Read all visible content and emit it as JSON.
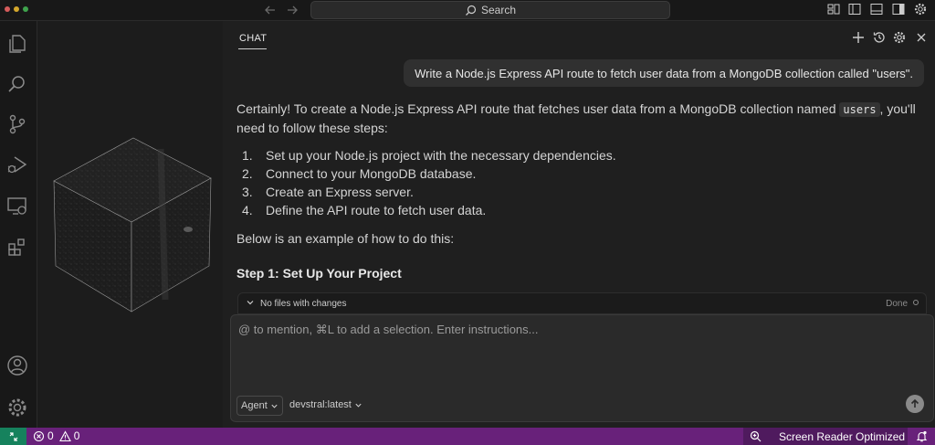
{
  "window": {
    "search_label": "Search"
  },
  "activity_bar": {
    "items": [
      "explorer-icon",
      "search-icon",
      "source-control-icon",
      "run-debug-icon",
      "remote-explorer-icon",
      "extensions-icon"
    ],
    "bottom": [
      "accounts-icon",
      "manage-gear-icon"
    ]
  },
  "chat": {
    "tab_label": "CHAT",
    "header_icons": [
      "new-chat-icon",
      "history-icon",
      "settings-icon",
      "close-icon"
    ],
    "user_message": "Write a Node.js Express API route to fetch user data from a MongoDB collection called \"users\".",
    "answer": {
      "intro_before_code": "Certainly! To create a Node.js Express API route that fetches user data from a MongoDB collection named ",
      "intro_code": "users",
      "intro_after_code": ", you'll need to follow these steps:",
      "steps": [
        {
          "num": "1.",
          "text": "Set up your Node.js project with the necessary dependencies."
        },
        {
          "num": "2.",
          "text": "Connect to your MongoDB database."
        },
        {
          "num": "3.",
          "text": "Create an Express server."
        },
        {
          "num": "4.",
          "text": "Define the API route to fetch user data."
        }
      ],
      "below_text": "Below is an example of how to do this:",
      "step1_heading": "Step 1: Set Up Your Project"
    },
    "changes_bar": {
      "label": "No files with changes",
      "done_label": "Done"
    },
    "input": {
      "placeholder": "@ to mention, ⌘L to add a selection. Enter instructions...",
      "value": "",
      "mode": "Agent",
      "model": "devstral:latest"
    }
  },
  "status_bar": {
    "errors": "0",
    "warnings": "0",
    "screen_reader": "Screen Reader Optimized",
    "colors": {
      "background": "#68217a",
      "remote": "#16825d"
    }
  }
}
